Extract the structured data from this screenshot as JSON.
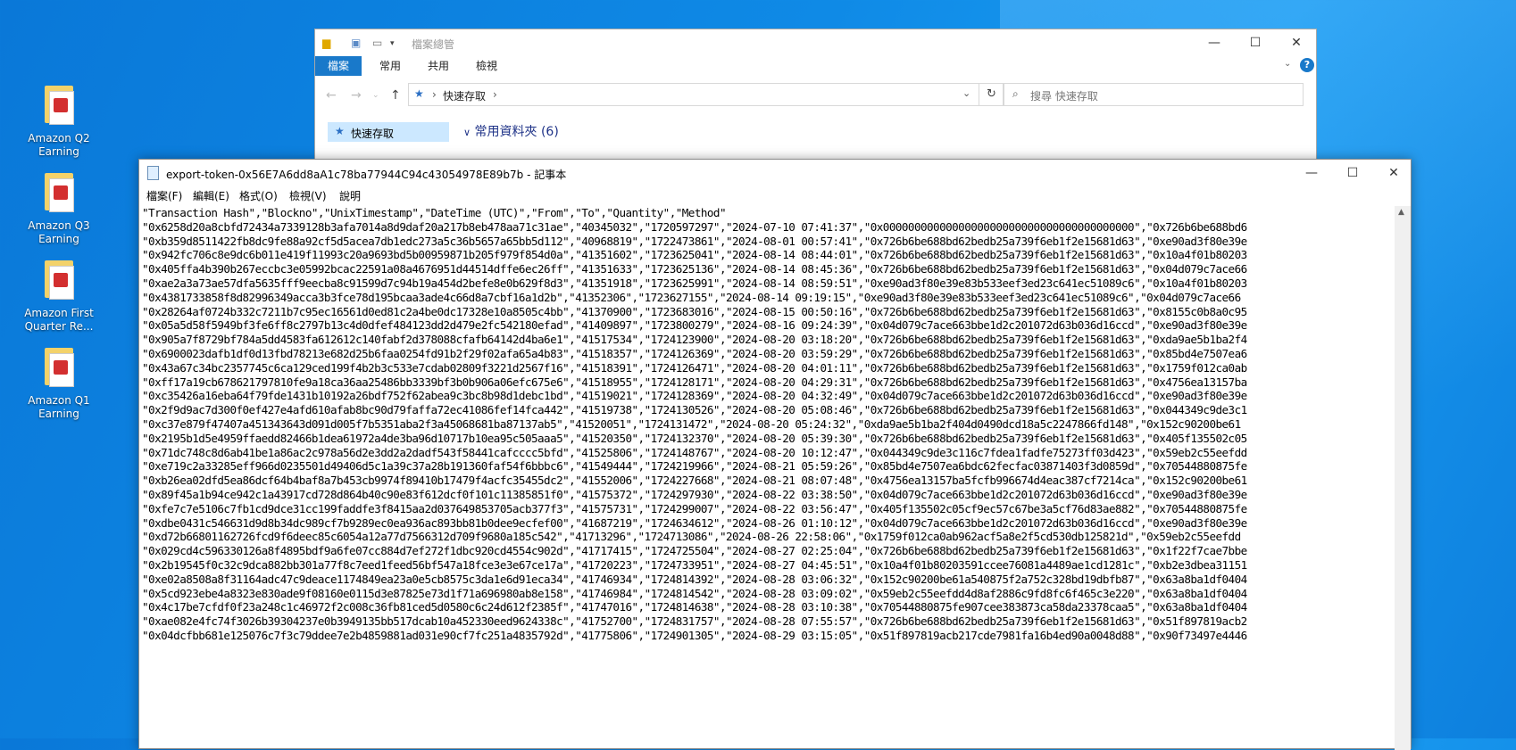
{
  "desktop": {
    "icons": [
      {
        "label": "Amazon Q2 Earning"
      },
      {
        "label": "Amazon Q3 Earning"
      },
      {
        "label": "Amazon First Quarter Re..."
      },
      {
        "label": "Amazon Q1 Earning"
      }
    ]
  },
  "explorer": {
    "title": "檔案總管",
    "tabs": [
      "檔案",
      "常用",
      "共用",
      "檢視"
    ],
    "address": "快速存取",
    "search_placeholder": "搜尋 快速存取",
    "nav_item": "快速存取",
    "frequent_header": "常用資料夾 (6)"
  },
  "notepad": {
    "title": "export-token-0x56E7A6dd8aA1c78ba77944C94c43054978E89b7b - 記事本",
    "menus": [
      "檔案(F)",
      "編輯(E)",
      "格式(O)",
      "檢視(V)",
      "說明"
    ],
    "lines": [
      "\"Transaction Hash\",\"Blockno\",\"UnixTimestamp\",\"DateTime (UTC)\",\"From\",\"To\",\"Quantity\",\"Method\"",
      "\"0x6258d20a8cbfd72434a7339128b3afa7014a8d9daf20a217b8eb478aa71c31ae\",\"40345032\",\"1720597297\",\"2024-07-10 07:41:37\",\"0x0000000000000000000000000000000000000000\",\"0x726b6be688bd6",
      "\"0xb359d8511422fb8dc9fe88a92cf5d5acea7db1edc273a5c36b5657a65bb5d112\",\"40968819\",\"1722473861\",\"2024-08-01 00:57:41\",\"0x726b6be688bd62bedb25a739f6eb1f2e15681d63\",\"0xe90ad3f80e39e",
      "\"0x942fc706c8e9dc6b011e419f11993c20a9693bd5b00959871b205f979f854d0a\",\"41351602\",\"1723625041\",\"2024-08-14 08:44:01\",\"0x726b6be688bd62bedb25a739f6eb1f2e15681d63\",\"0x10a4f01b80203",
      "\"0x405ffa4b390b267eccbc3e05992bcac22591a08a4676951d44514dffe6ec26ff\",\"41351633\",\"1723625136\",\"2024-08-14 08:45:36\",\"0x726b6be688bd62bedb25a739f6eb1f2e15681d63\",\"0x04d079c7ace66",
      "\"0xae2a3a73ae57dfa5635fff9eecba8c91599d7c94b19a454d2befe8e0b629f8d3\",\"41351918\",\"1723625991\",\"2024-08-14 08:59:51\",\"0xe90ad3f80e39e83b533eef3ed23c641ec51089c6\",\"0x10a4f01b80203",
      "\"0x4381733858f8d82996349acca3b3fce78d195bcaa3ade4c66d8a7cbf16a1d2b\",\"41352306\",\"1723627155\",\"2024-08-14 09:19:15\",\"0xe90ad3f80e39e83b533eef3ed23c641ec51089c6\",\"0x04d079c7ace66",
      "\"0x28264af0724b332c7211b7c95ec16561d0ed81c2a4be0dc17328e10a8505c4bb\",\"41370900\",\"1723683016\",\"2024-08-15 00:50:16\",\"0x726b6be688bd62bedb25a739f6eb1f2e15681d63\",\"0x8155c0b8a0c95",
      "\"0x05a5d58f5949bf3fe6ff8c2797b13c4d0dfef484123dd2d479e2fc542180efad\",\"41409897\",\"1723800279\",\"2024-08-16 09:24:39\",\"0x04d079c7ace663bbe1d2c201072d63b036d16ccd\",\"0xe90ad3f80e39e",
      "\"0x905a7f8729bf784a5dd4583fa612612c140fabf2d378088cfafb64142d4ba6e1\",\"41517534\",\"1724123900\",\"2024-08-20 03:18:20\",\"0x726b6be688bd62bedb25a739f6eb1f2e15681d63\",\"0xda9ae5b1ba2f4",
      "\"0x6900023dafb1df0d13fbd78213e682d25b6faa0254fd91b2f29f02afa65a4b83\",\"41518357\",\"1724126369\",\"2024-08-20 03:59:29\",\"0x726b6be688bd62bedb25a739f6eb1f2e15681d63\",\"0x85bd4e7507ea6",
      "\"0x43a67c34bc2357745c6ca129ced199f4b2b3c533e7cdab02809f3221d2567f16\",\"41518391\",\"1724126471\",\"2024-08-20 04:01:11\",\"0x726b6be688bd62bedb25a739f6eb1f2e15681d63\",\"0x1759f012ca0ab",
      "\"0xff17a19cb678621797810fe9a18ca36aa25486bb3339bf3b0b906a06efc675e6\",\"41518955\",\"1724128171\",\"2024-08-20 04:29:31\",\"0x726b6be688bd62bedb25a739f6eb1f2e15681d63\",\"0x4756ea13157ba",
      "\"0xc35426a16eba64f79fde1431b10192a26bdf752f62abea9c3bc8b98d1debc1bd\",\"41519021\",\"1724128369\",\"2024-08-20 04:32:49\",\"0x04d079c7ace663bbe1d2c201072d63b036d16ccd\",\"0xe90ad3f80e39e",
      "\"0x2f9d9ac7d300f0ef427e4afd610afab8bc90d79faffa72ec41086fef14fca442\",\"41519738\",\"1724130526\",\"2024-08-20 05:08:46\",\"0x726b6be688bd62bedb25a739f6eb1f2e15681d63\",\"0x044349c9de3c1",
      "\"0xc37e879f47407a451343643d091d005f7b5351aba2f3a45068681ba87137ab5\",\"41520051\",\"1724131472\",\"2024-08-20 05:24:32\",\"0xda9ae5b1ba2f404d0490dcd18a5c2247866fd148\",\"0x152c90200be61",
      "\"0x2195b1d5e4959ffaedd82466b1dea61972a4de3ba96d10717b10ea95c505aaa5\",\"41520350\",\"1724132370\",\"2024-08-20 05:39:30\",\"0x726b6be688bd62bedb25a739f6eb1f2e15681d63\",\"0x405f135502c05",
      "\"0x71dc748c8d6ab41be1a86ac2c978a56d2e3dd2a2dadf543f58441cafcccc5bfd\",\"41525806\",\"1724148767\",\"2024-08-20 10:12:47\",\"0x044349c9de3c116c7fdea1fadfe75273ff03d423\",\"0x59eb2c55eefdd",
      "\"0xe719c2a33285eff966d0235501d49406d5c1a39c37a28b191360faf54f6bbbc6\",\"41549444\",\"1724219966\",\"2024-08-21 05:59:26\",\"0x85bd4e7507ea6bdc62fecfac03871403f3d0859d\",\"0x70544880875fe",
      "\"0xb26ea02dfd5ea86dcf64b4baf8a7b453cb9974f89410b17479f4acfc35455dc2\",\"41552006\",\"1724227668\",\"2024-08-21 08:07:48\",\"0x4756ea13157ba5fcfb996674d4eac387cf7214ca\",\"0x152c90200be61",
      "\"0x89f45a1b94ce942c1a43917cd728d864b40c90e83f612dcf0f101c11385851f0\",\"41575372\",\"1724297930\",\"2024-08-22 03:38:50\",\"0x04d079c7ace663bbe1d2c201072d63b036d16ccd\",\"0xe90ad3f80e39e",
      "\"0xfe7c7e5106c7fb1cd9dce31cc199faddfe3f8415aa2d037649853705acb377f3\",\"41575731\",\"1724299007\",\"2024-08-22 03:56:47\",\"0x405f135502c05cf9ec57c67be3a5cf76d83ae882\",\"0x70544880875fe",
      "\"0xdbe0431c546631d9d8b34dc989cf7b9289ec0ea936ac893bb81b0dee9ecfef00\",\"41687219\",\"1724634612\",\"2024-08-26 01:10:12\",\"0x04d079c7ace663bbe1d2c201072d63b036d16ccd\",\"0xe90ad3f80e39e",
      "\"0xd72b66801162726fcd9f6deec85c6054a12a77d7566312d709f9680a185c542\",\"41713296\",\"1724713086\",\"2024-08-26 22:58:06\",\"0x1759f012ca0ab962acf5a8e2f5cd530db125821d\",\"0x59eb2c55eefdd",
      "\"0x029cd4c596330126a8f4895bdf9a6fe07cc884d7ef272f1dbc920cd4554c902d\",\"41717415\",\"1724725504\",\"2024-08-27 02:25:04\",\"0x726b6be688bd62bedb25a739f6eb1f2e15681d63\",\"0x1f22f7cae7bbe",
      "\"0x2b19545f0c32c9dca882bb301a77f8c7eed1feed56bf547a18fce3e3e67ce17a\",\"41720223\",\"1724733951\",\"2024-08-27 04:45:51\",\"0x10a4f01b80203591ccee76081a4489ae1cd1281c\",\"0xb2e3dbea31151",
      "\"0xe02a8508a8f31164adc47c9deace1174849ea23a0e5cb8575c3da1e6d91eca34\",\"41746934\",\"1724814392\",\"2024-08-28 03:06:32\",\"0x152c90200be61a540875f2a752c328bd19dbfb87\",\"0x63a8ba1df0404",
      "\"0x5cd923ebe4a8323e830ade9f08160e0115d3e87825e73d1f71a696980ab8e158\",\"41746984\",\"1724814542\",\"2024-08-28 03:09:02\",\"0x59eb2c55eefdd4d8af2886c9fd8fc6f465c3e220\",\"0x63a8ba1df0404",
      "\"0x4c17be7cfdf0f23a248c1c46972f2c008c36fb81ced5d0580c6c24d612f2385f\",\"41747016\",\"1724814638\",\"2024-08-28 03:10:38\",\"0x70544880875fe907cee383873ca58da23378caa5\",\"0x63a8ba1df0404",
      "\"0xae082e4fc74f3026b39304237e0b3949135bb517dcab10a452330eed9624338c\",\"41752700\",\"1724831757\",\"2024-08-28 07:55:57\",\"0x726b6be688bd62bedb25a739f6eb1f2e15681d63\",\"0x51f897819acb2",
      "\"0x04dcfbb681e125076c7f3c79ddee7e2b4859881ad031e90cf7fc251a4835792d\",\"41775806\",\"1724901305\",\"2024-08-29 03:15:05\",\"0x51f897819acb217cde7981fa16b4ed90a0048d88\",\"0x90f73497e4446"
    ]
  }
}
